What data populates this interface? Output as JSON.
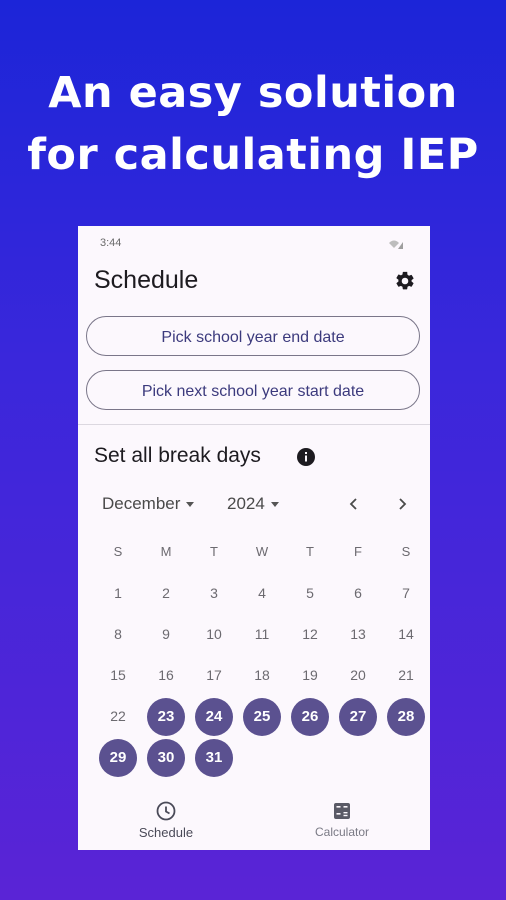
{
  "headline": {
    "line1": "An easy solution",
    "line2": "for calculating IEP"
  },
  "status_bar": {
    "time": "3:44"
  },
  "app": {
    "title": "Schedule",
    "buttons": {
      "end_date": "Pick school year end date",
      "start_date": "Pick next school year start date"
    },
    "breaks": {
      "title": "Set all break days",
      "month": "December",
      "year": "2024",
      "day_names": [
        "S",
        "M",
        "T",
        "W",
        "T",
        "F",
        "S"
      ],
      "first_weekday_index": 0,
      "days_in_month": 31,
      "selected_days": [
        23,
        24,
        25,
        26,
        27,
        28,
        29,
        30,
        31
      ]
    },
    "bottom_nav": [
      {
        "label": "Schedule",
        "icon": "clock-icon",
        "active": true
      },
      {
        "label": "Calculator",
        "icon": "calculator-icon",
        "active": false
      }
    ]
  },
  "colors": {
    "accent": "#5b5190",
    "button_text": "#3c3a7d",
    "background_top": "#1c25d8",
    "background_bottom": "#5a24d6"
  }
}
